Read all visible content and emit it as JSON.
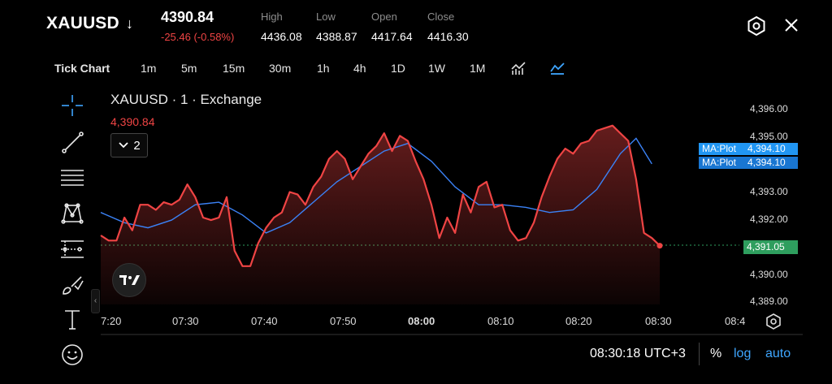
{
  "header": {
    "symbol": "XAUUSD",
    "direction_icon": "arrow-down-icon",
    "price": "4390.84",
    "change": "-25.46 (-0.58%)",
    "stats": [
      {
        "label": "High",
        "value": "4436.08"
      },
      {
        "label": "Low",
        "value": "4388.87"
      },
      {
        "label": "Open",
        "value": "4417.64"
      },
      {
        "label": "Close",
        "value": "4416.30"
      }
    ],
    "settings_icon": "settings-hexagon-icon",
    "close_icon": "close-icon"
  },
  "timeframes": [
    "Tick Chart",
    "1m",
    "5m",
    "15m",
    "30m",
    "1h",
    "4h",
    "1D",
    "1W",
    "1M"
  ],
  "chart_type_icons": [
    "candles-chart-icon",
    "area-chart-icon"
  ],
  "toolbar": [
    "crosshair-icon",
    "trend-line-icon",
    "fib-lines-icon",
    "pattern-icon",
    "measure-icon",
    "brush-icon",
    "text-icon",
    "emoji-icon"
  ],
  "legend": {
    "title": "XAUUSD · 1 · Exchange",
    "price": "4,390.84",
    "indicator_count": "2"
  },
  "price_axis": {
    "labels": [
      "4,396.00",
      "4,395.00",
      "4,393.00",
      "4,392.00",
      "4,390.00",
      "4,389.00"
    ],
    "ma_label": "MA:Plot",
    "ma_values": [
      "4,394.10",
      "4,394.10"
    ],
    "current_price": "4,391.05"
  },
  "time_axis": [
    "7:20",
    "07:30",
    "07:40",
    "07:50",
    "08:00",
    "08:10",
    "08:20",
    "08:30",
    "08:4"
  ],
  "footer": {
    "time": "08:30:18 UTC+3",
    "percent": "%",
    "log": "log",
    "auto": "auto"
  },
  "colors": {
    "price_line": "#ef4444",
    "ma_line": "#3b82f6",
    "current_tag": "#2e9e5e",
    "accent": "#3ea6ff"
  },
  "chart_data": {
    "type": "area",
    "title": "XAUUSD · 1 · Exchange",
    "xlabel": "",
    "ylabel": "",
    "x_range": [
      "07:19",
      "08:30"
    ],
    "ylim": [
      4388.6,
      4397.4
    ],
    "series": [
      {
        "name": "XAUUSD",
        "x": [
          "07:19",
          "07:20",
          "07:21",
          "07:22",
          "07:23",
          "07:24",
          "07:25",
          "07:26",
          "07:27",
          "07:28",
          "07:29",
          "07:30",
          "07:31",
          "07:32",
          "07:33",
          "07:34",
          "07:35",
          "07:36",
          "07:37",
          "07:38",
          "07:39",
          "07:40",
          "07:41",
          "07:42",
          "07:43",
          "07:44",
          "07:45",
          "07:46",
          "07:47",
          "07:48",
          "07:49",
          "07:50",
          "07:51",
          "07:52",
          "07:53",
          "07:54",
          "07:55",
          "07:56",
          "07:57",
          "07:58",
          "07:59",
          "08:00",
          "08:01",
          "08:02",
          "08:03",
          "08:04",
          "08:05",
          "08:06",
          "08:07",
          "08:08",
          "08:09",
          "08:10",
          "08:11",
          "08:12",
          "08:13",
          "08:14",
          "08:15",
          "08:16",
          "08:17",
          "08:18",
          "08:19",
          "08:20",
          "08:21",
          "08:22",
          "08:23",
          "08:24",
          "08:25",
          "08:26",
          "08:27",
          "08:28",
          "08:29",
          "08:30"
        ],
        "values": [
          4391.3,
          4391.1,
          4391.1,
          4392.0,
          4391.5,
          4392.5,
          4392.5,
          4392.3,
          4392.6,
          4392.5,
          4392.7,
          4393.3,
          4392.8,
          4392.0,
          4391.9,
          4392.0,
          4392.8,
          4390.7,
          4390.1,
          4390.1,
          4391.0,
          4391.6,
          4392.0,
          4392.2,
          4393.0,
          4392.9,
          4392.5,
          4393.2,
          4393.6,
          4394.3,
          4394.6,
          4394.3,
          4393.5,
          4394.0,
          4394.5,
          4394.8,
          4395.3,
          4394.6,
          4395.2,
          4395.0,
          4394.2,
          4393.5,
          4392.5,
          4391.2,
          4392.0,
          4391.4,
          4392.9,
          4392.2,
          4393.2,
          4393.4,
          4392.4,
          4392.5,
          4391.5,
          4391.1,
          4391.2,
          4391.8,
          4392.8,
          4393.6,
          4394.3,
          4394.7,
          4394.5,
          4394.9,
          4395.0,
          4395.4,
          4395.5,
          4395.6,
          4395.3,
          4395.0,
          4393.5,
          4391.4,
          4391.2,
          4390.9
        ]
      },
      {
        "name": "MA:Plot",
        "x": [
          "07:19",
          "07:22",
          "07:25",
          "07:28",
          "07:31",
          "07:34",
          "07:37",
          "07:40",
          "07:43",
          "07:46",
          "07:49",
          "07:52",
          "07:55",
          "07:58",
          "08:01",
          "08:04",
          "08:07",
          "08:10",
          "08:13",
          "08:16",
          "08:19",
          "08:22",
          "08:25",
          "08:27",
          "08:29"
        ],
        "values": [
          4392.2,
          4391.8,
          4391.6,
          4391.9,
          4392.5,
          4392.6,
          4392.1,
          4391.4,
          4391.8,
          4392.6,
          4393.4,
          4394.0,
          4394.6,
          4394.9,
          4394.2,
          4393.2,
          4392.5,
          4392.5,
          4392.4,
          4392.2,
          4392.3,
          4393.1,
          4394.5,
          4395.1,
          4394.1
        ]
      }
    ],
    "last_price": 4391.05,
    "grid": false,
    "y_ticks": [
      4396.0,
      4395.0,
      4393.0,
      4392.0,
      4390.0,
      4389.0
    ],
    "x_ticks": [
      "7:20",
      "07:30",
      "07:40",
      "07:50",
      "08:00",
      "08:10",
      "08:20",
      "08:30",
      "08:4"
    ]
  }
}
